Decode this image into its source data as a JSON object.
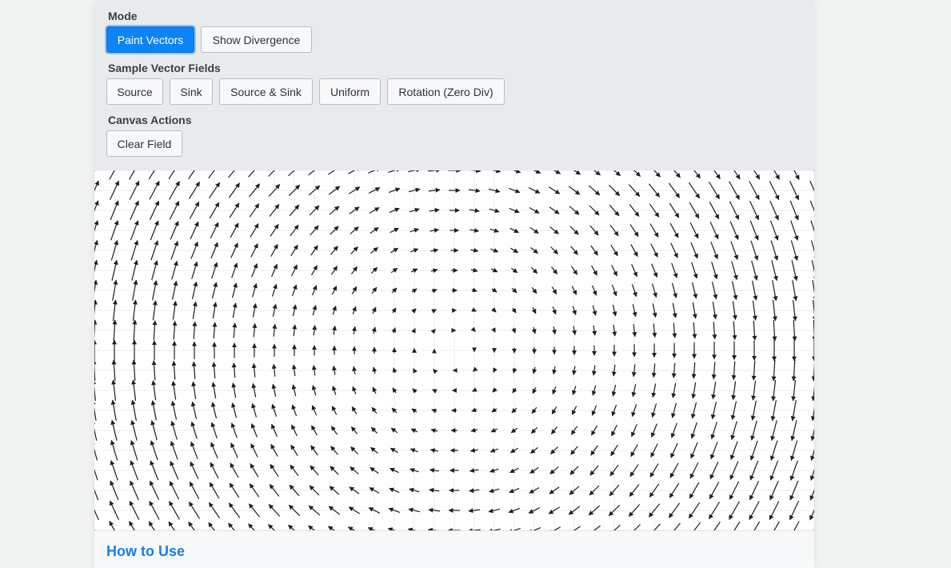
{
  "mode": {
    "label": "Mode",
    "paint_vectors": "Paint Vectors",
    "show_divergence": "Show Divergence",
    "active": "Paint Vectors"
  },
  "samples": {
    "label": "Sample Vector Fields",
    "source": "Source",
    "sink": "Sink",
    "source_sink": "Source & Sink",
    "uniform": "Uniform",
    "rotation": "Rotation (Zero Div)"
  },
  "canvas_actions": {
    "label": "Canvas Actions",
    "clear_field": "Clear Field"
  },
  "canvas": {
    "field_type": "rotation-clockwise",
    "grid_visible": true
  },
  "help": {
    "title": "How to Use"
  },
  "colors": {
    "accent": "#0d84f5",
    "arrow": "#1f1f1f",
    "grid": "#eeeeee",
    "link": "#1a7fe0"
  }
}
